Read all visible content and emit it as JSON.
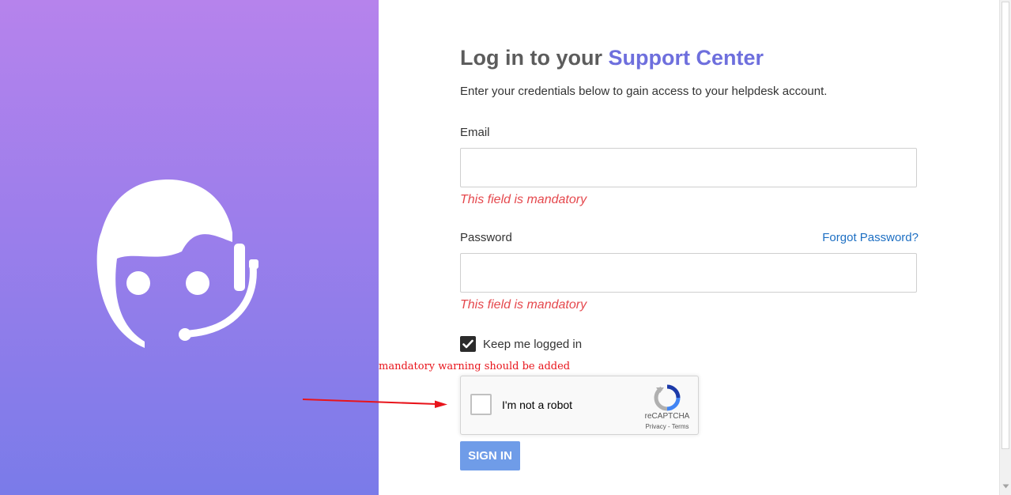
{
  "login": {
    "title_prefix": "Log in to your ",
    "title_accent": "Support Center",
    "subtitle": "Enter your credentials below to gain access to your helpdesk account.",
    "email_label": "Email",
    "email_value": "",
    "email_error": "This field is mandatory",
    "password_label": "Password",
    "password_value": "",
    "password_error": "This field is mandatory",
    "forgot_password": "Forgot Password?",
    "keep_logged_in": "Keep me logged in",
    "keep_logged_in_checked": true,
    "sign_in_label": "SIGN IN"
  },
  "recaptcha": {
    "label": "I'm not a robot",
    "brand": "reCAPTCHA",
    "links": "Privacy - Terms",
    "icon": "recaptcha-logo-icon"
  },
  "annotation": {
    "text": "mandatory warning should be added",
    "color": "#e8141b"
  },
  "illustration": {
    "icon": "support-agent-icon"
  },
  "colors": {
    "accent": "#6e6fdd",
    "error": "#e5484d",
    "link": "#1d6fc3",
    "button": "#6f9ce8",
    "gradient_top": "#b683ec",
    "gradient_bottom": "#7a7be9"
  }
}
